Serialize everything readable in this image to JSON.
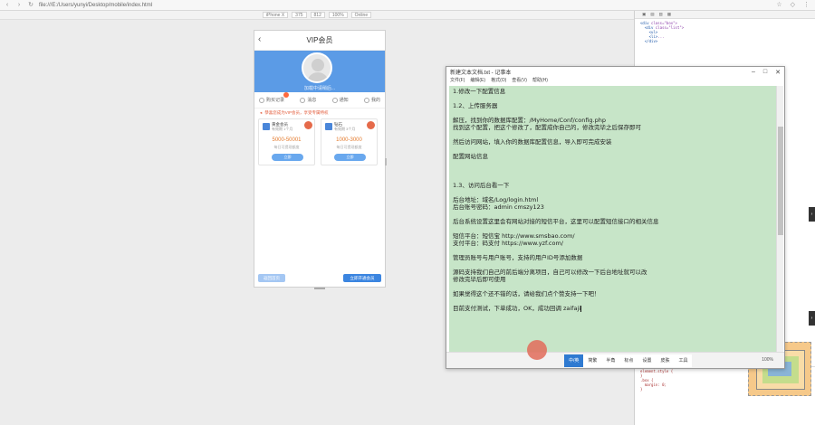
{
  "browser": {
    "url": "file:///E:/Users/yunyi/Desktop/mobile/index.html",
    "device_options": [
      "iPhone X",
      "375",
      "812",
      "100%",
      "Online"
    ]
  },
  "phone": {
    "title": "VIP会员",
    "banner_caption": "加载中请稍后...",
    "tabs": [
      "购买记录",
      "消息",
      "通知",
      "我的"
    ],
    "notice": "恭喜您成为VIP会员，享受专属特权",
    "cards": [
      {
        "title": "黄金会员",
        "sub": "有效期 1个月",
        "price": "5000-50001",
        "caption": "每日可提现额度",
        "button": "立即"
      },
      {
        "title": "钻石",
        "sub": "有效期 3个月",
        "price": "1000-3000",
        "caption": "每日可提现额度",
        "button": "立即"
      }
    ],
    "footer_left": "返回首页",
    "footer_right": "立即开通会员"
  },
  "notepad": {
    "title": "新建文本文档.txt - 记事本",
    "menu": [
      "文件(F)",
      "编辑(E)",
      "格式(O)",
      "查看(V)",
      "帮助(H)"
    ],
    "lines": [
      "1.修改一下配置信息",
      "",
      "1.2、上传服务器",
      "",
      "解压，找到你的数据库配置：/MyHome/Conf/config.php",
      "找到这个配置，把这个修改了，配置成你自己的，修改完毕之后保存即可",
      "",
      "然后访问网站，填入你的数据库配置信息，导入即可完成安装",
      "",
      "配置网站信息",
      "",
      "",
      "",
      "1.3、访问后台看一下",
      "",
      "后台地址：域名/Log/login.html",
      "后台账号密码：admin  cmszy123",
      "",
      "后台系统设置这里会有网站对接的短信平台，这里可以配置短信接口的相关信息",
      "",
      "短信平台：短信宝 http://www.smsbao.com/",
      "支付平台：码支付 https://www.yzf.com/",
      "",
      "管理员账号与用户账号，支持的用户ID号添加数据",
      "",
      "源码支持我们自己的前后端分离项目，自己可以修改一下后台地址就可以改",
      "修改完毕后即可使用",
      "",
      "如果觉得这个还不错的话，请给我们点个赞支持一下吧！",
      "",
      "目前支付测试，下单成功，OK，"
    ],
    "last_line_prefix": "目前支付测试，下单成功，OK，",
    "last_line_highlight": "成功回调",
    "last_line_typed": "zaifaji",
    "ime_items": [
      "中/英",
      "简繁",
      "半角",
      "标点",
      "设置",
      "皮肤",
      "工具"
    ],
    "zoom": "100%"
  }
}
